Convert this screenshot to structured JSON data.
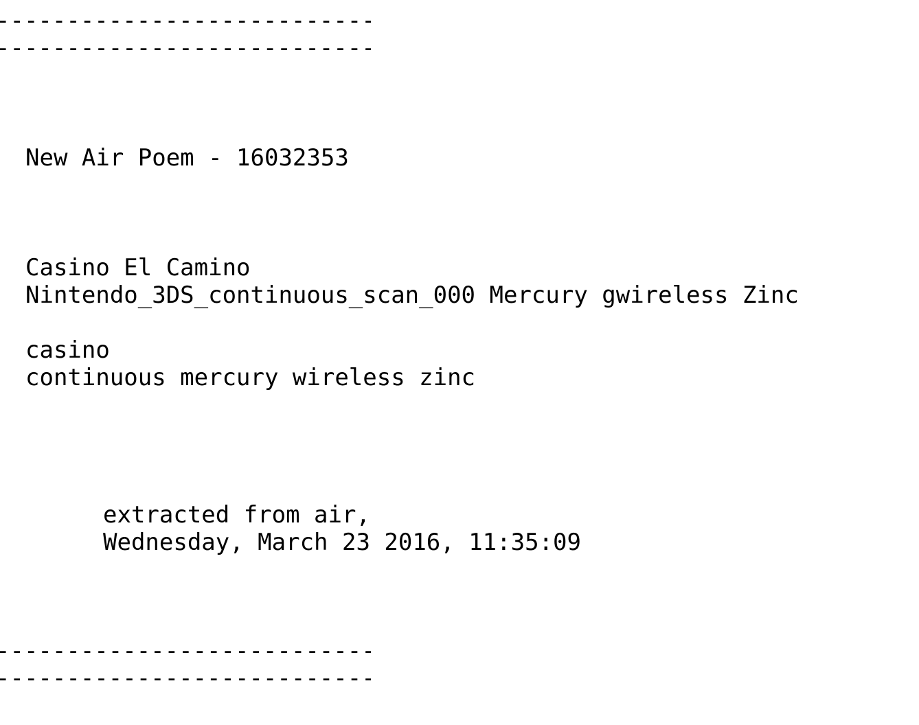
{
  "rules": {
    "top_1": "------------------------------",
    "top_2": "------------------------------",
    "bottom_1": "------------------------------",
    "bottom_2": "------------------------------"
  },
  "poem": {
    "title": "New Air Poem - 16032353",
    "networks": [
      "Casino El Camino",
      "Nintendo_3DS_continuous_scan_000 Mercury gwireless Zinc"
    ],
    "words": [
      "casino",
      "continuous mercury wireless zinc"
    ],
    "credit": [
      "extracted from air,",
      "Wednesday, March 23 2016, 11:35:09"
    ]
  }
}
